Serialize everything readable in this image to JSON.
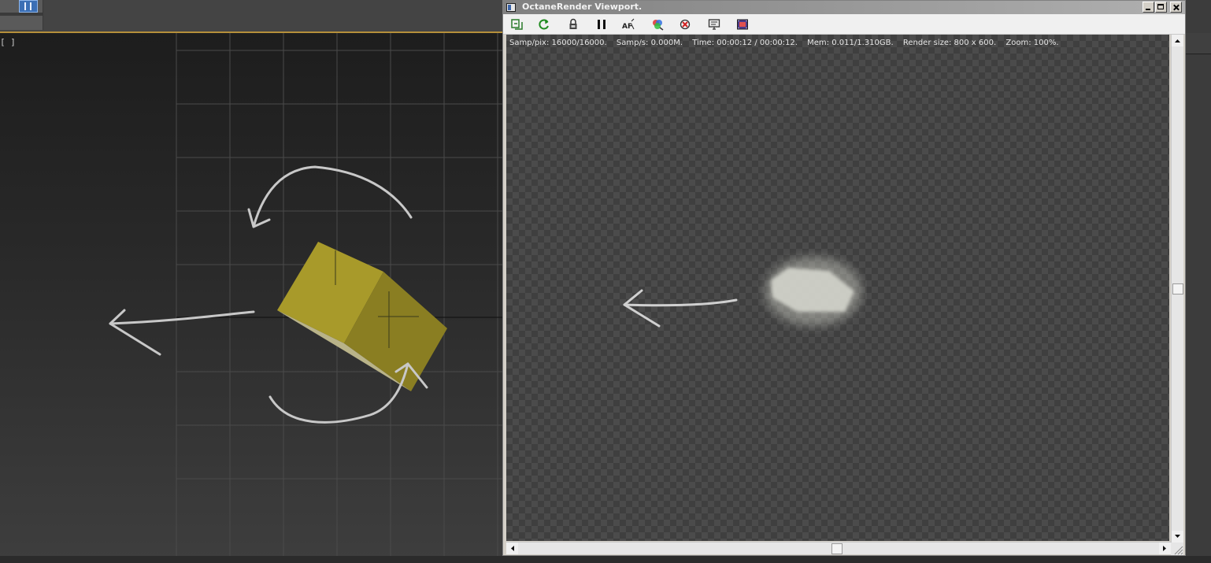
{
  "left_viewport": {
    "label": "[ ]"
  },
  "octane": {
    "title": "OctaneRender Viewport.",
    "toolbar": [
      {
        "name": "send-scene-icon"
      },
      {
        "name": "restart-icon"
      },
      {
        "name": "lock-icon"
      },
      {
        "name": "pause-icon"
      },
      {
        "name": "focus-picker-icon"
      },
      {
        "name": "color-picker-icon"
      },
      {
        "name": "clear-icon"
      },
      {
        "name": "display-icon"
      },
      {
        "name": "film-icon"
      }
    ],
    "stats": {
      "samp_pix": "Samp/pix: 16000/16000.",
      "samp_s": "Samp/s: 0.000M.",
      "time": "Time: 00:00:12 / 00:00:12.",
      "mem": "Mem: 0.011/1.310GB.",
      "render_size": "Render size: 800 x 600.",
      "zoom": "Zoom: 100%."
    },
    "colors": {
      "cube_light": "#a89a2a",
      "cube_dark": "#8a7e22",
      "viewport_border": "#b58f3a"
    }
  }
}
